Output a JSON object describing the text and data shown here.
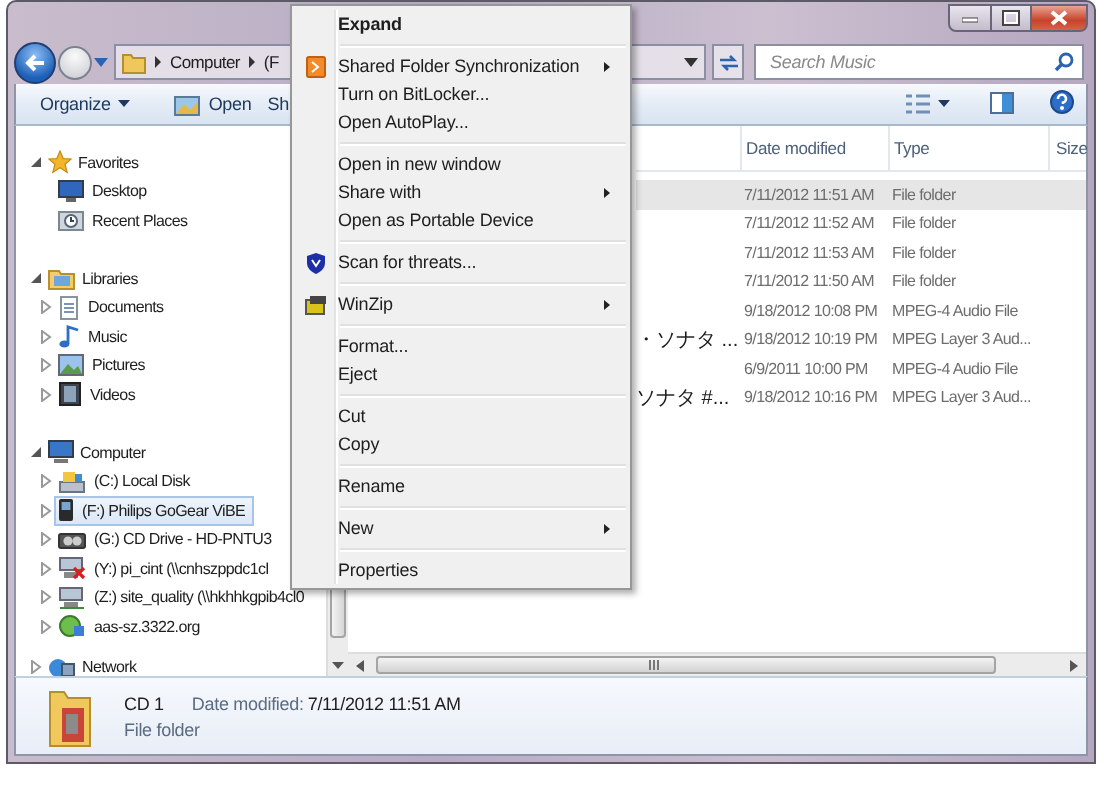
{
  "address_bar": {
    "crumbs": [
      "Computer",
      "(F"
    ]
  },
  "search": {
    "placeholder": "Search Music"
  },
  "toolbar": {
    "buttons": [
      {
        "label": "Organize",
        "dropdown": true
      },
      {
        "label": "Open",
        "dropdown": false
      },
      {
        "label": "Sh",
        "dropdown": false
      }
    ]
  },
  "nav_pane": {
    "groups": [
      {
        "label": "Favorites",
        "expanded": true,
        "selected": false,
        "children": [
          {
            "label": "Desktop",
            "selected": false
          },
          {
            "label": "Recent Places",
            "selected": false
          }
        ]
      },
      {
        "label": "Libraries",
        "expanded": true,
        "selected": false,
        "children": [
          {
            "label": "Documents",
            "expanded": false,
            "selected": false
          },
          {
            "label": "Music",
            "expanded": false,
            "selected": false
          },
          {
            "label": "Pictures",
            "expanded": false,
            "selected": false
          },
          {
            "label": "Videos",
            "expanded": false,
            "selected": false
          }
        ]
      },
      {
        "label": "Computer",
        "expanded": true,
        "selected": false,
        "children": [
          {
            "label": "(C:) Local Disk",
            "expanded": false,
            "selected": false
          },
          {
            "label": "(F:) Philips GoGear ViBE",
            "expanded": false,
            "selected": true
          },
          {
            "label": "(G:) CD Drive - HD-PNTU3",
            "expanded": false,
            "selected": false
          },
          {
            "label": "(Y:) pi_cint (\\\\cnhszppdc1cl",
            "expanded": false,
            "selected": false
          },
          {
            "label": "(Z:) site_quality (\\\\hkhhkgpib4cl0",
            "expanded": false,
            "selected": false
          },
          {
            "label": "aas-sz.3322.org",
            "expanded": false,
            "selected": false
          }
        ]
      },
      {
        "label": "Network",
        "expanded": false,
        "selected": false
      }
    ]
  },
  "file_list": {
    "columns": [
      "Date modified",
      "Type",
      "Size"
    ],
    "rows": [
      {
        "date": "7/11/2012 11:51 AM",
        "type": "File folder",
        "selected": true
      },
      {
        "date": "7/11/2012 11:52 AM",
        "type": "File folder",
        "selected": false
      },
      {
        "date": "7/11/2012 11:53 AM",
        "type": "File folder",
        "selected": false
      },
      {
        "date": "7/11/2012 11:50 AM",
        "type": "File folder",
        "selected": false
      },
      {
        "date": "9/18/2012 10:08 PM",
        "type": "MPEG-4 Audio File",
        "selected": false
      },
      {
        "name": "・ソナタ ...",
        "date": "9/18/2012 10:19 PM",
        "type": "MPEG Layer 3 Aud...",
        "selected": false
      },
      {
        "date": "6/9/2011 10:00 PM",
        "type": "MPEG-4 Audio File",
        "selected": false
      },
      {
        "name": "ソナタ #...",
        "date": "9/18/2012 10:16 PM",
        "type": "MPEG Layer 3 Aud...",
        "selected": false
      }
    ]
  },
  "details": {
    "name": "CD 1",
    "date_label": "Date modified:",
    "date": "7/11/2012 11:51 AM",
    "type": "File folder"
  },
  "context_menu": {
    "items": [
      {
        "kind": "default",
        "label": "Expand",
        "submenu": false
      },
      {
        "kind": "separator"
      },
      {
        "kind": "item",
        "label": "Shared Folder Synchronization",
        "submenu": true
      },
      {
        "kind": "item",
        "label": "Turn on BitLocker...",
        "submenu": false
      },
      {
        "kind": "item",
        "label": "Open AutoPlay...",
        "submenu": false
      },
      {
        "kind": "separator"
      },
      {
        "kind": "item",
        "label": "Open in new window",
        "submenu": false
      },
      {
        "kind": "item",
        "label": "Share with",
        "submenu": true
      },
      {
        "kind": "item",
        "label": "Open as Portable Device",
        "submenu": false
      },
      {
        "kind": "separator"
      },
      {
        "kind": "item",
        "label": "Scan for threats...",
        "submenu": false
      },
      {
        "kind": "separator"
      },
      {
        "kind": "item",
        "label": "WinZip",
        "submenu": true
      },
      {
        "kind": "separator"
      },
      {
        "kind": "item",
        "label": "Format...",
        "submenu": false
      },
      {
        "kind": "item",
        "label": "Eject",
        "submenu": false
      },
      {
        "kind": "separator"
      },
      {
        "kind": "item",
        "label": "Cut",
        "submenu": false
      },
      {
        "kind": "item",
        "label": "Copy",
        "submenu": false
      },
      {
        "kind": "separator"
      },
      {
        "kind": "item",
        "label": "Rename",
        "submenu": false
      },
      {
        "kind": "separator"
      },
      {
        "kind": "item",
        "label": "New",
        "submenu": true
      },
      {
        "kind": "separator"
      },
      {
        "kind": "item",
        "label": "Properties",
        "submenu": false
      }
    ]
  }
}
